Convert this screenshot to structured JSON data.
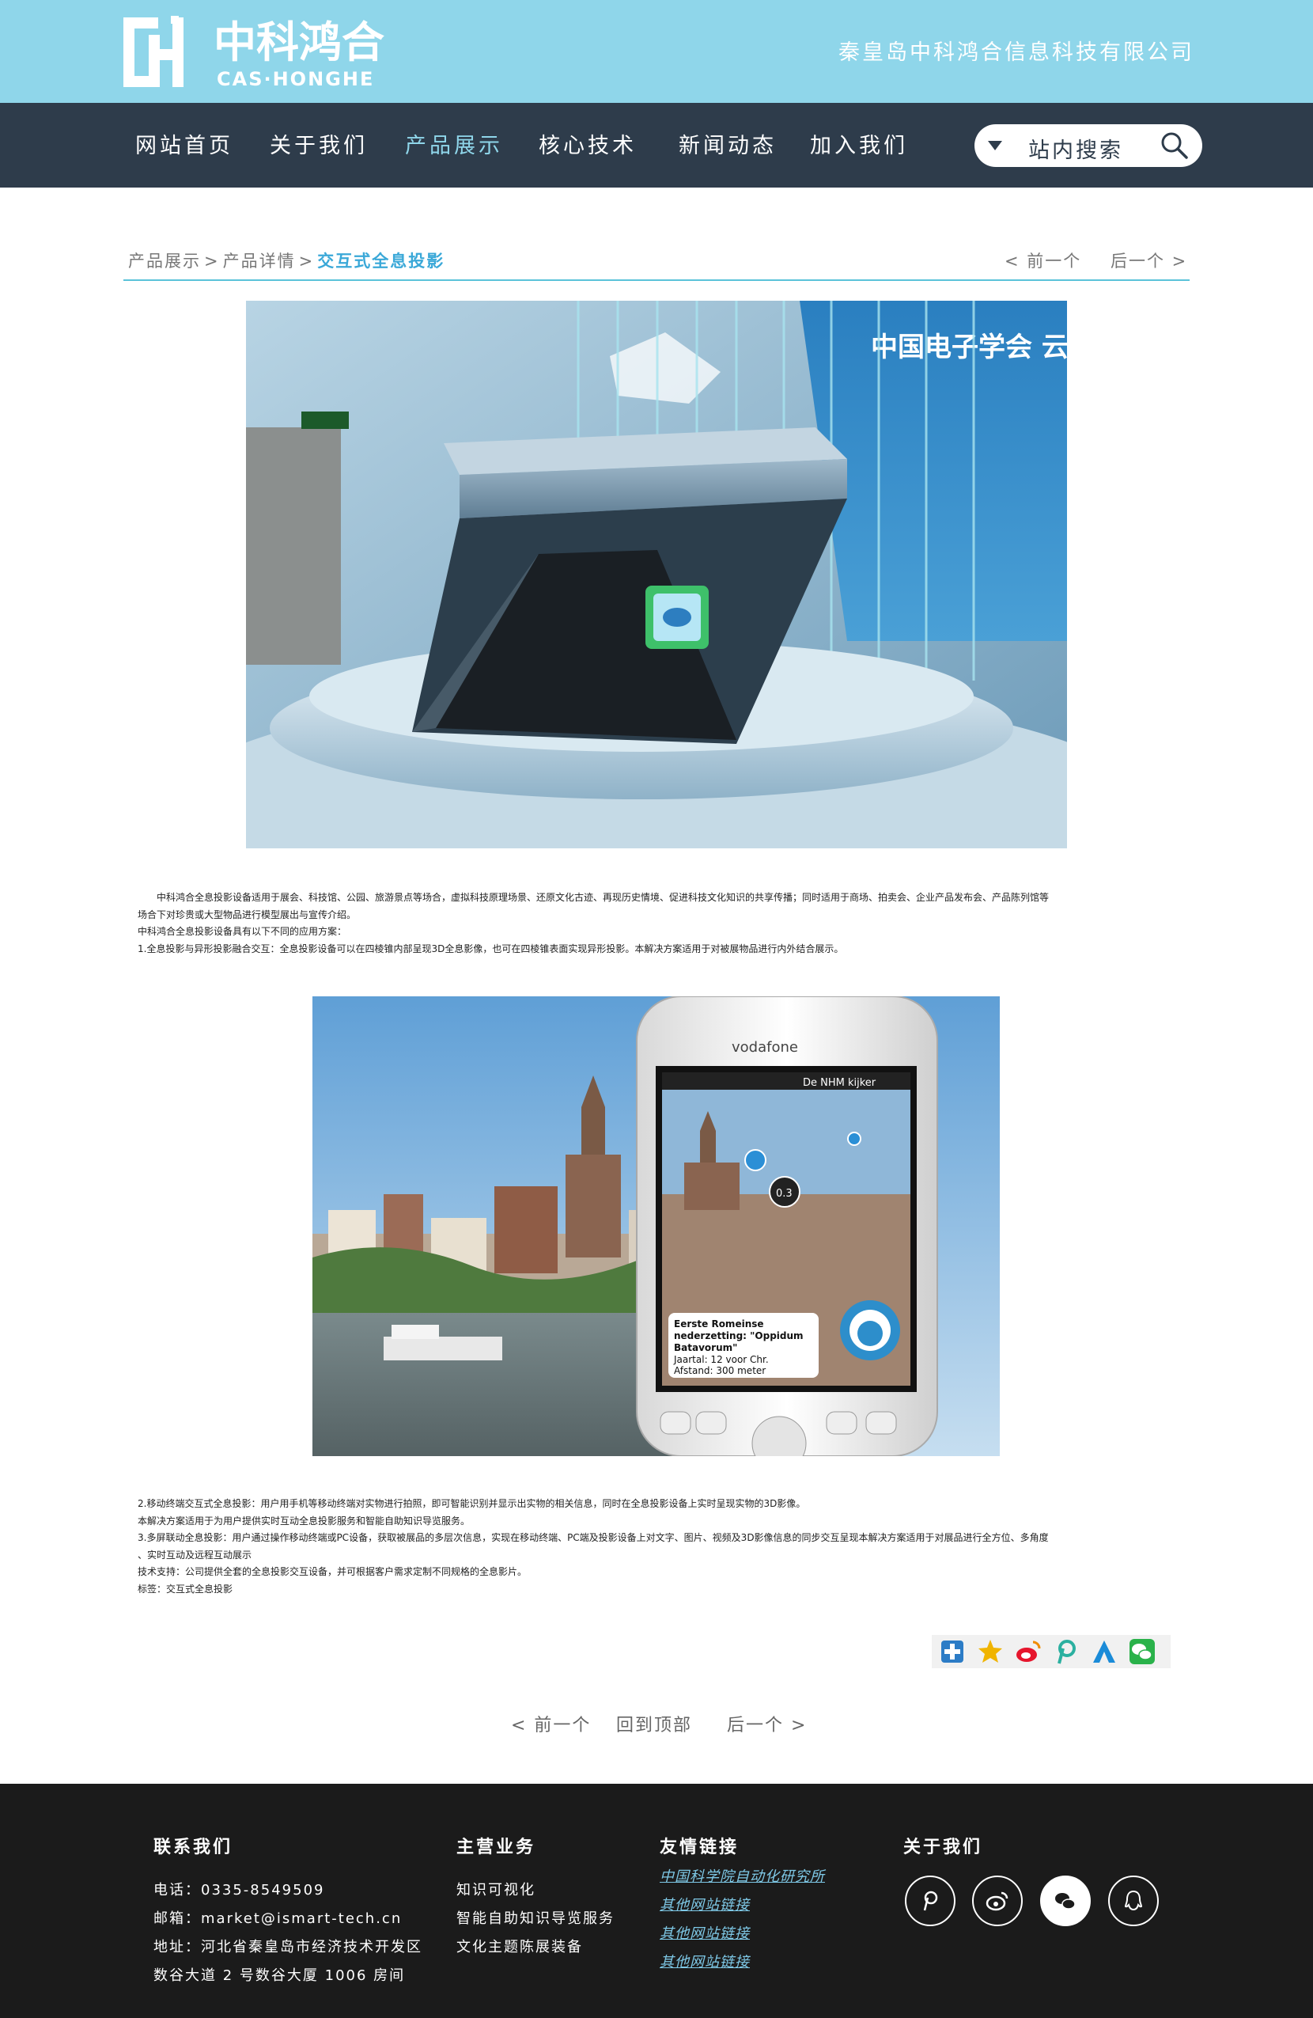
{
  "header": {
    "logo_chinese": "中科鸿合",
    "logo_english": "CAS·HONGHE",
    "company_name": "秦皇岛中科鸿合信息科技有限公司",
    "background_color": "#8fd6ea"
  },
  "nav": {
    "items": [
      {
        "label": "网站首页"
      },
      {
        "label": "关于我们"
      },
      {
        "label": "产品展示",
        "active": true
      },
      {
        "label": "核心技术"
      },
      {
        "label": "新闻动态"
      },
      {
        "label": "加入我们"
      }
    ],
    "search_label": "站内搜索",
    "active_color": "#8fd6ea"
  },
  "breadcrumb": {
    "items": [
      "产品展示",
      "产品详情"
    ],
    "separator": ">",
    "current": "交互式全息投影"
  },
  "pager": {
    "prev": "< 前一个",
    "next": "后一个 >",
    "top": "回到顶部"
  },
  "article": {
    "hero_sign": "中国电子学会 云计算专家",
    "para1": [
      "中科鸿合全息投影设备适用于展会、科技馆、公园、旅游景点等场合，虚拟科技原理场景、还原文化古迹、再现历史情境、促进科技文化知识的共享传播；同时适用于商场、拍卖会、企业产品发布会、产品陈列馆等",
      "场合下对珍贵或大型物品进行模型展出与宣传介绍。",
      "中科鸿合全息投影设备具有以下不同的应用方案：",
      "1.全息投影与异形投影融合交互：全息投影设备可以在四棱锥内部呈现3D全息影像，也可在四棱锥表面实现异形投影。本解决方案适用于对被展物品进行内外结合展示。"
    ],
    "phone_screen": {
      "brand": "vodafone",
      "app_title": "De NHM kijker",
      "marker_value": "0.3",
      "info_line1": "Eerste Romeinse",
      "info_line2": "nederzetting: \"Oppidum",
      "info_line3": "Batavorum\"",
      "info_line4": "Jaartal: 12 voor Chr.",
      "info_line5": "Afstand: 300 meter"
    },
    "para2": [
      "2.移动终端交互式全息投影：用户用手机等移动终端对实物进行拍照，即可智能识别并显示出实物的相关信息，同时在全息投影设备上实时呈现实物的3D影像。",
      "本解决方案适用于为用户提供实时互动全息投影服务和智能自助知识导览服务。",
      "3.多屏联动全息投影：用户通过操作移动终端或PC设备，获取被展品的多层次信息，实现在移动终端、PC端及投影设备上对文字、图片、视频及3D影像信息的同步交互呈现本解决方案适用于对展品进行全方位、多角度",
      "、实时互动及远程互动展示",
      "技术支持：公司提供全套的全息投影交互设备，并可根据客户需求定制不同规格的全息影片。",
      "标签：交互式全息投影"
    ]
  },
  "share_icons": [
    "plus-share-icon",
    "qzone-star-icon",
    "weibo-icon",
    "pinterest-icon",
    "tencent-weibo-icon",
    "wechat-icon"
  ],
  "footer": {
    "contact": {
      "title": "联系我们",
      "phone": "电话：0335-8549509",
      "email": "邮箱：market@ismart-tech.cn",
      "address1": "地址：河北省秦皇岛市经济技术开发区",
      "address2": "数谷大道 2 号数谷大厦 1006 房间"
    },
    "business": {
      "title": "主营业务",
      "items": [
        "知识可视化",
        "智能自助知识导览服务",
        "文化主题陈展装备"
      ]
    },
    "links": {
      "title": "友情链接",
      "items": [
        "中国科学院自动化研究所",
        "其他网站链接",
        "其他网站链接",
        "其他网站链接"
      ]
    },
    "about": {
      "title": "关于我们",
      "icons": [
        "pinterest-icon",
        "weibo-icon",
        "wechat-icon",
        "qq-icon"
      ]
    }
  }
}
